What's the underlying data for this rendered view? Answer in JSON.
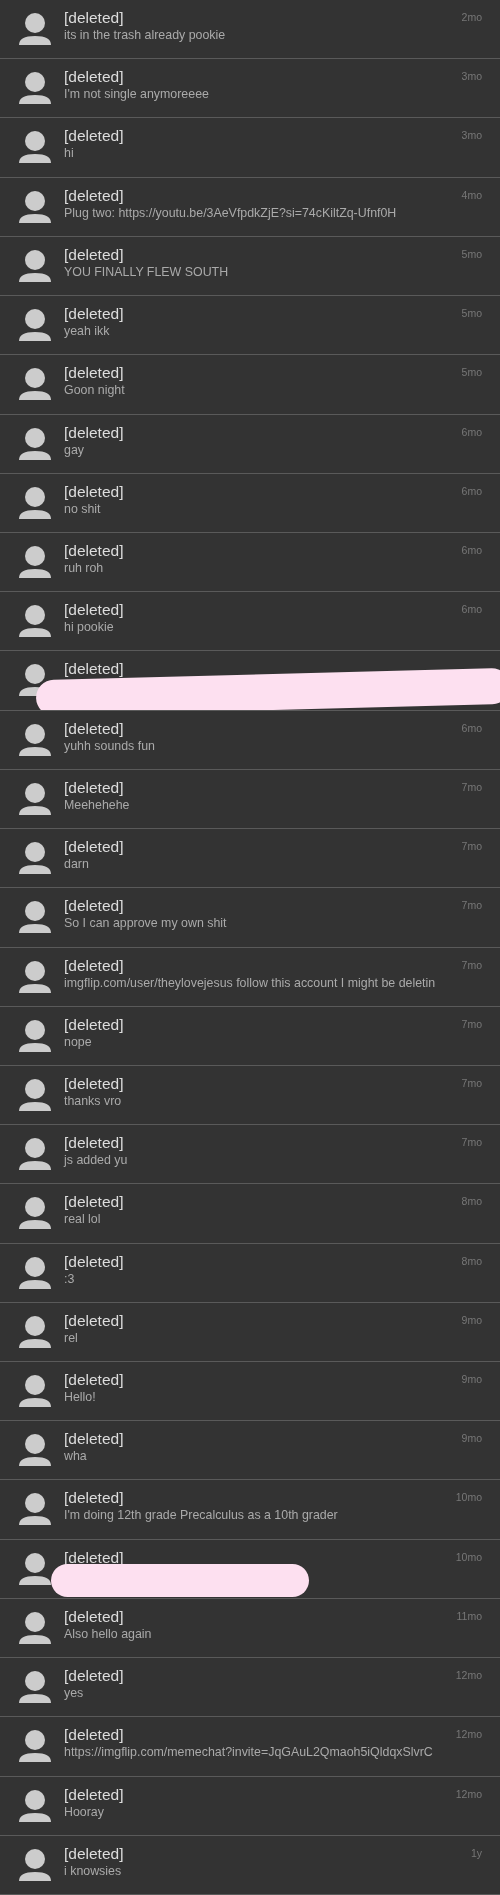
{
  "messages": [
    {
      "name": "[deleted]",
      "text": "its in the trash already pookie",
      "time": "2mo"
    },
    {
      "name": "[deleted]",
      "text": "I'm not single anymoreeee",
      "time": "3mo"
    },
    {
      "name": "[deleted]",
      "text": "hi",
      "time": "3mo"
    },
    {
      "name": "[deleted]",
      "text": "Plug two: https://youtu.be/3AeVfpdkZjE?si=74cKiltZq-Ufnf0H",
      "time": "4mo"
    },
    {
      "name": "[deleted]",
      "text": "YOU FINALLY FLEW SOUTH",
      "time": "5mo"
    },
    {
      "name": "[deleted]",
      "text": "yeah ikk",
      "time": "5mo"
    },
    {
      "name": "[deleted]",
      "text": "Goon night",
      "time": "5mo"
    },
    {
      "name": "[deleted]",
      "text": "gay",
      "time": "6mo"
    },
    {
      "name": "[deleted]",
      "text": "no shit",
      "time": "6mo"
    },
    {
      "name": "[deleted]",
      "text": "ruh roh",
      "time": "6mo"
    },
    {
      "name": "[deleted]",
      "text": "hi pookie",
      "time": "6mo"
    },
    {
      "name": "[deleted]",
      "redacted": true
    },
    {
      "name": "[deleted]",
      "text": "yuhh sounds fun",
      "time": "6mo"
    },
    {
      "name": "[deleted]",
      "text": "Meehehehe",
      "time": "7mo"
    },
    {
      "name": "[deleted]",
      "text": "darn",
      "time": "7mo"
    },
    {
      "name": "[deleted]",
      "text": "So I can approve my own shit",
      "time": "7mo"
    },
    {
      "name": "[deleted]",
      "text": "imgflip.com/user/theylovejesus follow this account I might be deletin",
      "time": "7mo"
    },
    {
      "name": "[deleted]",
      "text": "nope",
      "time": "7mo"
    },
    {
      "name": "[deleted]",
      "text": "thanks vro",
      "time": "7mo"
    },
    {
      "name": "[deleted]",
      "text": "js added yu",
      "time": "7mo"
    },
    {
      "name": "[deleted]",
      "text": "real lol",
      "time": "8mo"
    },
    {
      "name": "[deleted]",
      "text": ":3",
      "time": "8mo"
    },
    {
      "name": "[deleted]",
      "text": "rel",
      "time": "9mo"
    },
    {
      "name": "[deleted]",
      "text": "Hello!",
      "time": "9mo"
    },
    {
      "name": "[deleted]",
      "text": "wha",
      "time": "9mo"
    },
    {
      "name": "[deleted]",
      "text": "I'm doing 12th grade Precalculus as a 10th grader",
      "time": "10mo"
    },
    {
      "name": "[deleted]",
      "time": "10mo",
      "redacted": true
    },
    {
      "name": "[deleted]",
      "text": "Also hello again",
      "time": "11mo"
    },
    {
      "name": "[deleted]",
      "text": "yes",
      "time": "12mo"
    },
    {
      "name": "[deleted]",
      "text": "https://imgflip.com/memechat?invite=JqGAuL2Qmaoh5iQldqxSlvrC",
      "time": "12mo"
    },
    {
      "name": "[deleted]",
      "text": "Hooray",
      "time": "12mo"
    },
    {
      "name": "[deleted]",
      "text": "i knowsies",
      "time": "1y"
    }
  ]
}
